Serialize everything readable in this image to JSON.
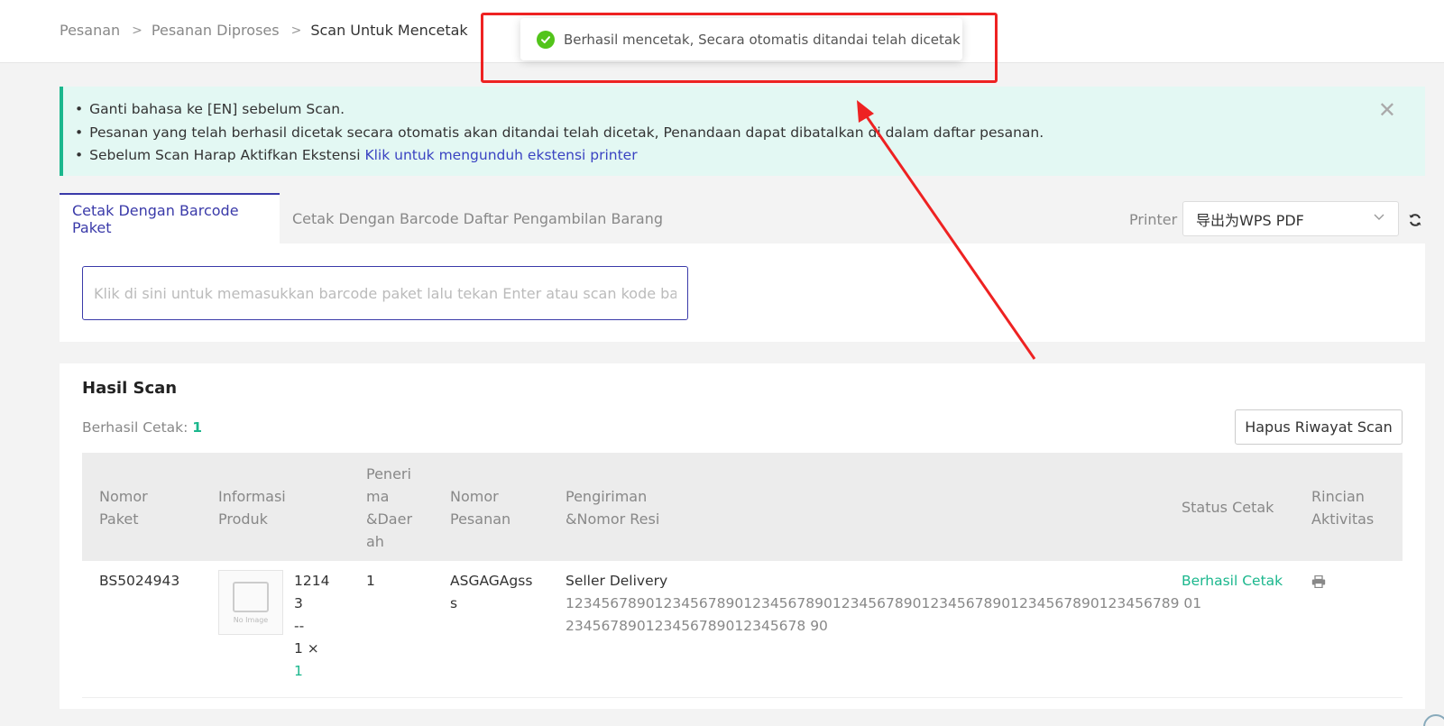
{
  "breadcrumb": {
    "item1": "Pesanan",
    "sep": ">",
    "item2": "Pesanan Diproses",
    "current": "Scan Untuk Mencetak"
  },
  "toast": {
    "icon": "check-circle-icon",
    "message": "Berhasil mencetak, Secara otomatis ditandai telah dicetak"
  },
  "notice": {
    "line1": "Ganti bahasa ke [EN] sebelum Scan.",
    "line2": "Pesanan yang telah berhasil dicetak secara otomatis akan ditandai telah dicetak, Penandaan dapat dibatalkan di dalam daftar pesanan.",
    "line3_prefix": "Sebelum Scan Harap Aktifkan Ekstensi ",
    "line3_link": "Klik untuk mengunduh ekstensi printer",
    "close_icon": "close-icon"
  },
  "tabs": {
    "active": "Cetak Dengan Barcode Paket",
    "inactive": "Cetak Dengan Barcode Daftar Pengambilan Barang"
  },
  "printer": {
    "label": "Printer",
    "selected": "导出为WPS PDF",
    "refresh_icon": "refresh-icon"
  },
  "scan_input": {
    "placeholder": "Klik di sini untuk memasukkan barcode paket lalu tekan Enter atau scan kode barcode p"
  },
  "results": {
    "title": "Hasil Scan",
    "success_label": "Berhasil Cetak: ",
    "success_count": "1",
    "clear_button": "Hapus Riwayat Scan"
  },
  "table": {
    "headers": {
      "package_no": [
        "Nomor",
        "Paket"
      ],
      "product_info": [
        "Informasi",
        "Produk"
      ],
      "recipient": [
        "Peneri",
        "ma",
        "&Daer",
        "ah"
      ],
      "order_no": [
        "Nomor",
        "Pesanan"
      ],
      "shipping": [
        "Pengiriman",
        "&Nomor Resi"
      ],
      "print_status": "Status Cetak",
      "activity": [
        "Rincian",
        "Aktivitas"
      ]
    },
    "row": {
      "package_no": "BS5024943",
      "product_image_text": "No Image",
      "product_id": [
        "1214",
        "3"
      ],
      "product_sep": "--",
      "product_qty": "1 ×",
      "product_qty_value": "1",
      "recipient": "1",
      "order_no": [
        "ASGAGAgss",
        "s"
      ],
      "shipping_method": "Seller Delivery",
      "tracking": [
        "123456789012345678901234567890123456789012345678901234567890123456789 01",
        "234567890123456789012345678 90"
      ],
      "print_status": "Berhasil Cetak",
      "activity_icon": "printer-icon"
    }
  },
  "colors": {
    "accent": "#3a3aa9",
    "success": "#1bb78d",
    "annotation": "#ee2222"
  }
}
